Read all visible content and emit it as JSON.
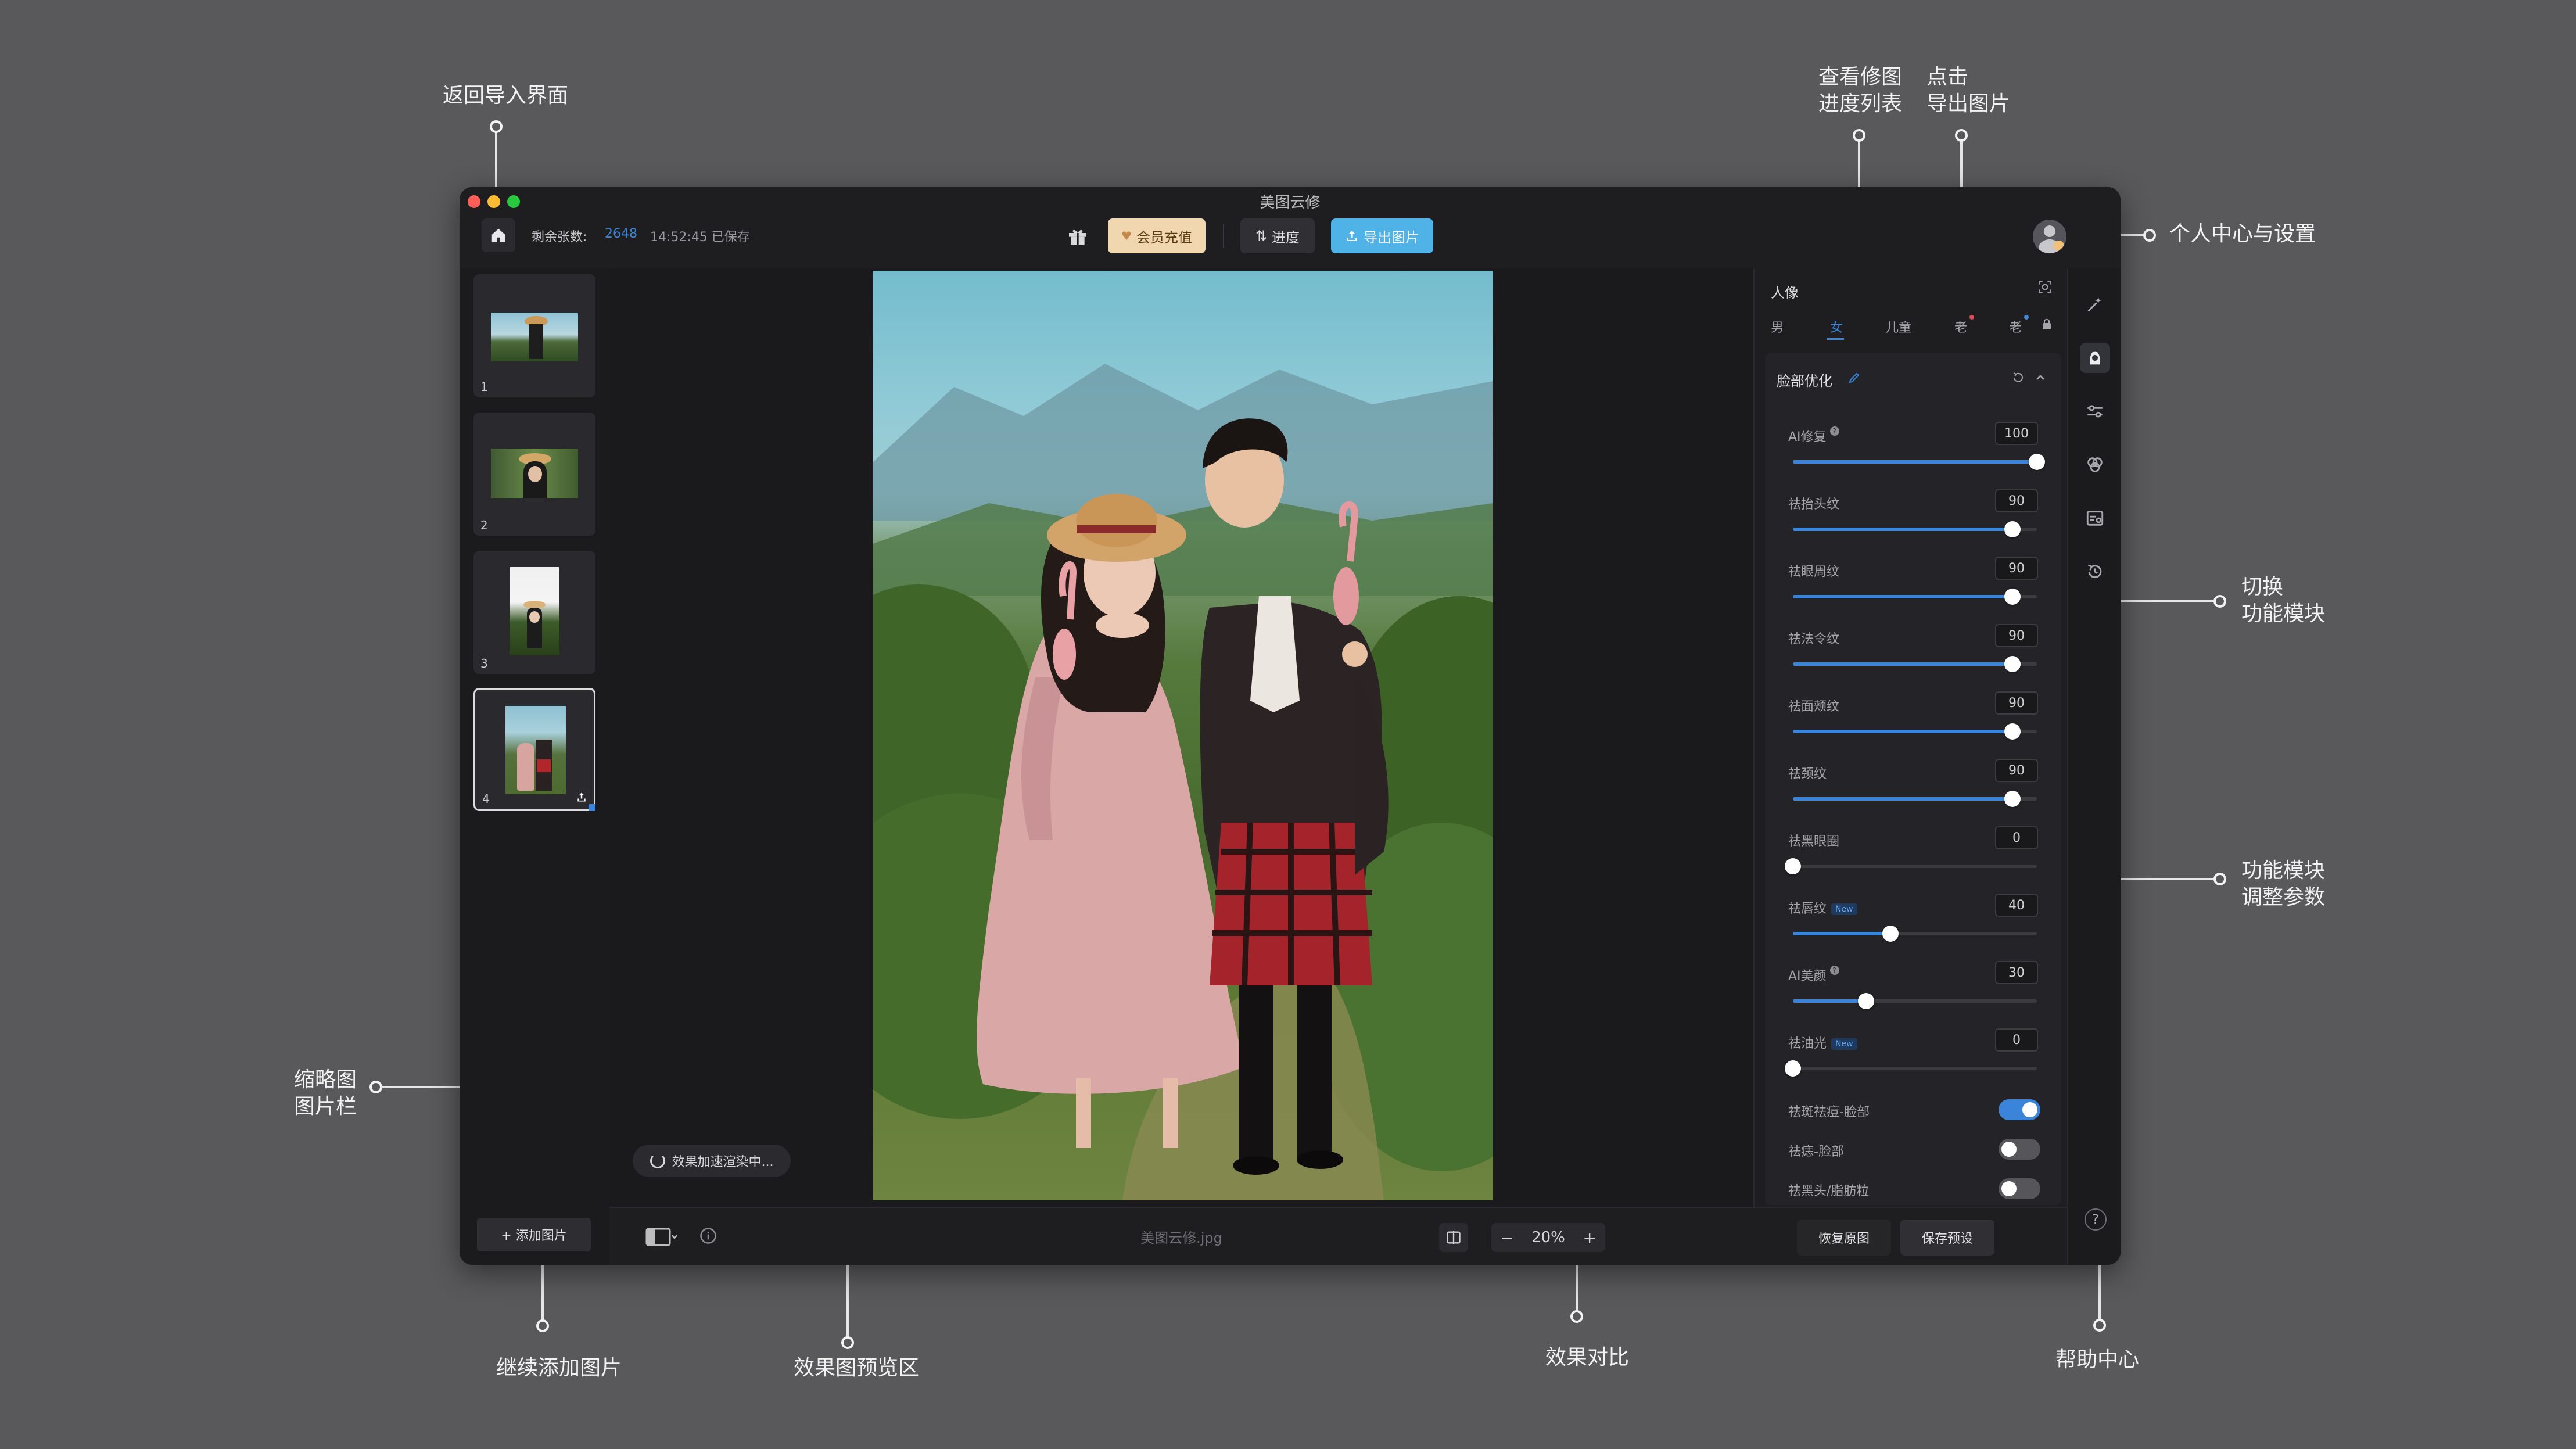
{
  "callouts": {
    "back_import": "返回导入界面",
    "progress_list": "查看修图\n进度列表",
    "export_click": "点击\n导出图片",
    "personal_center": "个人中心与设置",
    "switch_module": "切换\n功能模块",
    "adjust_params": "功能模块\n调整参数",
    "thumbnail_bar": "缩略图\n图片栏",
    "continue_add": "继续添加图片",
    "preview_area": "效果图预览区",
    "compare": "效果对比",
    "help_center": "帮助中心"
  },
  "window": {
    "title": "美图云修",
    "remaining_label": "剩余张数:",
    "remaining_count": "2648",
    "saved_status": "14:52:45 已保存",
    "vip_label": "会员充值",
    "progress_label": "进度",
    "export_label": "导出图片"
  },
  "thumbnails": [
    {
      "number": "1"
    },
    {
      "number": "2"
    },
    {
      "number": "3"
    },
    {
      "number": "4",
      "selected": true
    }
  ],
  "left_bottom": {
    "add_label": "+ 添加图片"
  },
  "preview": {
    "render_status": "效果加速渲染中...",
    "filename": "美图云修.jpg",
    "zoom": "20%",
    "zoom_minus": "−",
    "zoom_plus": "+"
  },
  "panel": {
    "title": "人像",
    "tabs": [
      "男",
      "女",
      "儿童",
      "老",
      "老"
    ],
    "active_tab": "女",
    "section_title": "脸部优化",
    "sliders": [
      {
        "label": "AI修复",
        "value": "100",
        "fraction": 1.0,
        "help": true
      },
      {
        "label": "祛抬头纹",
        "value": "90",
        "fraction": 0.9
      },
      {
        "label": "祛眼周纹",
        "value": "90",
        "fraction": 0.9
      },
      {
        "label": "祛法令纹",
        "value": "90",
        "fraction": 0.9
      },
      {
        "label": "祛面颊纹",
        "value": "90",
        "fraction": 0.9
      },
      {
        "label": "祛颈纹",
        "value": "90",
        "fraction": 0.9
      },
      {
        "label": "祛黑眼圈",
        "value": "0",
        "fraction": 0.0
      },
      {
        "label": "祛唇纹",
        "value": "40",
        "fraction": 0.4,
        "badge": "New"
      },
      {
        "label": "AI美颜",
        "value": "30",
        "fraction": 0.3,
        "help": true
      },
      {
        "label": "祛油光",
        "value": "0",
        "fraction": 0.0,
        "badge": "New"
      }
    ],
    "toggles": [
      {
        "label": "祛斑祛痘-脸部",
        "on": true
      },
      {
        "label": "祛痣-脸部",
        "on": false
      },
      {
        "label": "祛黑头/脂肪粒",
        "on": false
      }
    ],
    "restore_label": "恢复原图",
    "save_preset_label": "保存预设",
    "help_label": "?"
  },
  "colors": {
    "accent_blue": "#3a84d9",
    "export_button": "#4fb3e8",
    "vip_button": "#f1d7b0"
  },
  "icons": {
    "home": "home-icon",
    "gift": "gift-icon",
    "progress": "sort-arrows-icon",
    "export": "upload-icon",
    "avatar": "user-avatar",
    "edit": "pencil-icon",
    "reset": "reset-icon",
    "collapse": "chevron-up-icon",
    "compare": "split-compare-icon",
    "rail": [
      "magic-wand-icon",
      "portrait-icon",
      "sliders-icon",
      "color-circles-icon",
      "image-settings-icon",
      "history-icon"
    ]
  }
}
